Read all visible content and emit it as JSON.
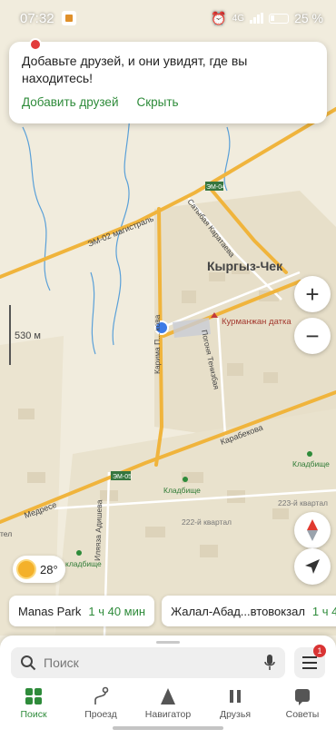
{
  "status": {
    "time": "07:32",
    "network": "4G",
    "battery": "25 %"
  },
  "popup": {
    "message": "Добавьте друзей, и они увидят, где вы находитесь!",
    "add_friends": "Добавить друзей",
    "hide": "Скрыть"
  },
  "map": {
    "city": "Кыргыз-Чек",
    "poi": "Курманжан датка",
    "roads": [
      "ЭМ-02 магистраль",
      "ЭМ-04",
      "Сатыбая Каратаева",
      "Карима П... кова",
      "Погоня Тенизбая",
      "Карабекова",
      "ЭМ-05",
      "Медресе",
      "Иляяза Адишева"
    ],
    "cemeteries": [
      "Кладбище",
      "Кладбище",
      "кладбище"
    ],
    "quarters": [
      "223-й квартал",
      "222-й квартал"
    ],
    "edge_label": "тел",
    "scale": "530 м"
  },
  "weather": {
    "temp": "28°"
  },
  "routes": [
    {
      "name": "Manas Park",
      "time": "1 ч 40 мин"
    },
    {
      "name": "Жалал-Абад...втовокзал",
      "time": "1 ч 4"
    }
  ],
  "search": {
    "placeholder": "Поиск"
  },
  "menu": {
    "badge": "1"
  },
  "tabs": [
    "Поиск",
    "Проезд",
    "Навигатор",
    "Друзья",
    "Советы"
  ],
  "colors": {
    "accent": "#2e8b3a",
    "road": "#f0b43c",
    "map_bg": "#f1ecdd",
    "location": "#3d7be6"
  }
}
